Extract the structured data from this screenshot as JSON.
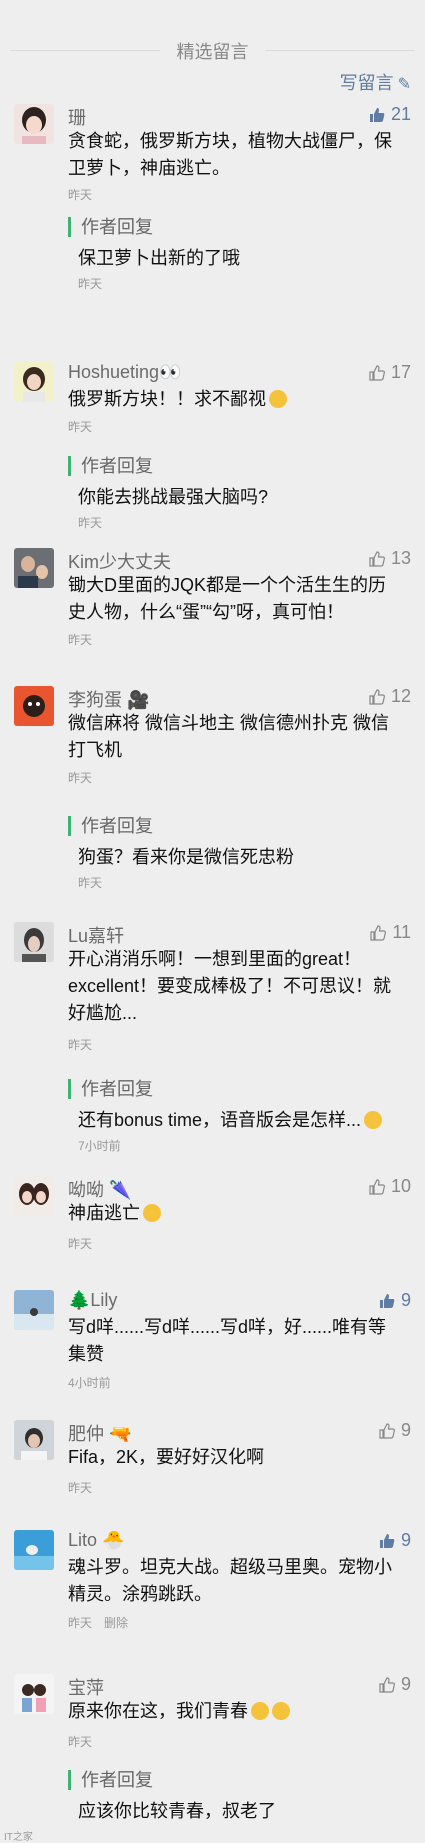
{
  "header": {
    "section_title": "精选留言",
    "write_label": "写留言"
  },
  "comments": [
    {
      "nick": "珊",
      "likes": "21",
      "liked": true,
      "text": "贪食蛇，俄罗斯方块，植物大战僵尸，保卫萝卜，神庙逃亡。",
      "time": "昨天",
      "reply": {
        "label": "作者回复",
        "text": "保卫萝卜出新的了哦",
        "time": "昨天"
      }
    },
    {
      "nick": "Hoshueting👀",
      "likes": "17",
      "liked": false,
      "text": "俄罗斯方块！！求不鄙视",
      "time": "昨天",
      "reply": {
        "label": "作者回复",
        "text": "你能去挑战最强大脑吗?",
        "time": "昨天"
      }
    },
    {
      "nick": "Kim少大丈夫",
      "likes": "13",
      "liked": false,
      "text": "锄大D里面的JQK都是一个个活生生的历史人物，什么“蛋”“勾”呀，真可怕！",
      "time": "昨天"
    },
    {
      "nick": "李狗蛋 🎥",
      "likes": "12",
      "liked": false,
      "text": "微信麻将 微信斗地主 微信德州扑克 微信打飞机",
      "time": "昨天",
      "reply": {
        "label": "作者回复",
        "text": "狗蛋？看来你是微信死忠粉",
        "time": "昨天"
      }
    },
    {
      "nick": "Lu嘉轩",
      "likes": "11",
      "liked": false,
      "text": "开心消消乐啊！一想到里面的great！excellent！要变成棒极了！不可思议！就好尴尬...",
      "time": "昨天",
      "reply": {
        "label": "作者回复",
        "text": "还有bonus time，语音版会是怎样...",
        "time": "7小时前"
      }
    },
    {
      "nick": "呦呦 🌂",
      "likes": "10",
      "liked": false,
      "text": "神庙逃亡",
      "time": "昨天"
    },
    {
      "nick": "🌲Lily",
      "likes": "9",
      "liked": true,
      "text": "写d咩......写d咩......写d咩，好......唯有等集赞",
      "time": "4小时前"
    },
    {
      "nick": "肥仲 🔫",
      "likes": "9",
      "liked": false,
      "text": "Fifa，2K，要好好汉化啊",
      "time": "昨天"
    },
    {
      "nick": "Lito 🐣",
      "likes": "9",
      "liked": true,
      "text": "魂斗罗。坦克大战。超级马里奥。宠物小精灵。涂鸦跳跃。",
      "time": "昨天",
      "delete": "删除"
    },
    {
      "nick": "宝萍",
      "likes": "9",
      "liked": false,
      "text": "原来你在这，我们青春",
      "time": "昨天",
      "reply": {
        "label": "作者回复",
        "text": "应该你比较青春，叔老了",
        "time": ""
      }
    }
  ],
  "watermark": "IT之家",
  "colors": {
    "background": "#eeeeee",
    "link": "#5f7da3",
    "reply_bar": "#3cb371",
    "muted": "#999999"
  },
  "icons": [
    "pencil-icon",
    "thumbs-up-icon",
    "emoji-icon"
  ]
}
